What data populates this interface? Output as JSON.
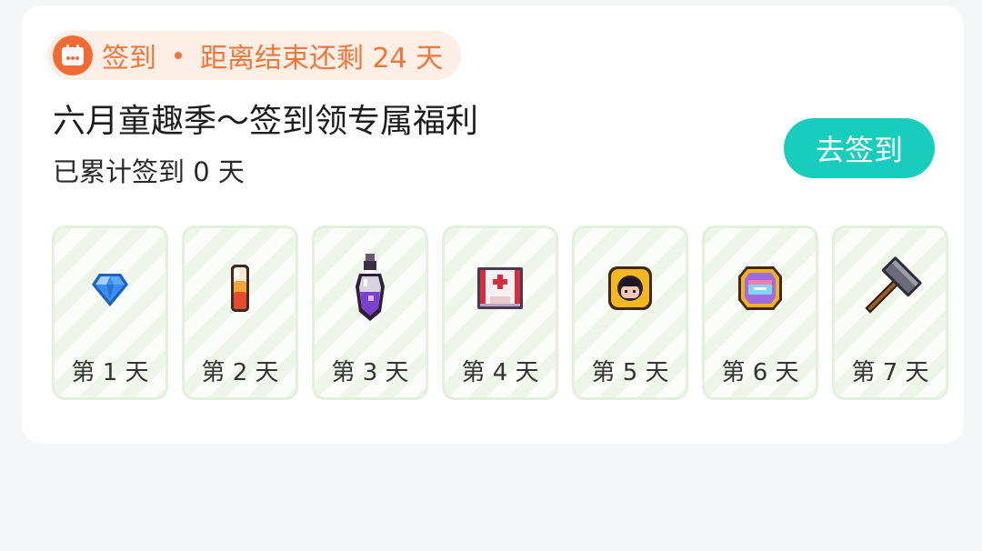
{
  "badge": {
    "label": "签到",
    "countdown": "距离结束还剩 24 天",
    "icon": "calendar-icon",
    "color": "#f26b32"
  },
  "title": "六月童趣季～签到领专属福利",
  "progress": "已累计签到 0 天",
  "cta_label": "去签到",
  "accent": "#19cdbd",
  "days": [
    {
      "label": "第 1 天",
      "icon": "blue-gem-icon"
    },
    {
      "label": "第 2 天",
      "icon": "potion-tube-icon"
    },
    {
      "label": "第 3 天",
      "icon": "purple-potion-bottle-icon"
    },
    {
      "label": "第 4 天",
      "icon": "medical-kit-icon"
    },
    {
      "label": "第 5 天",
      "icon": "avatar-frame-icon"
    },
    {
      "label": "第 6 天",
      "icon": "treasure-box-icon"
    },
    {
      "label": "第 7 天",
      "icon": "hammer-icon"
    }
  ]
}
